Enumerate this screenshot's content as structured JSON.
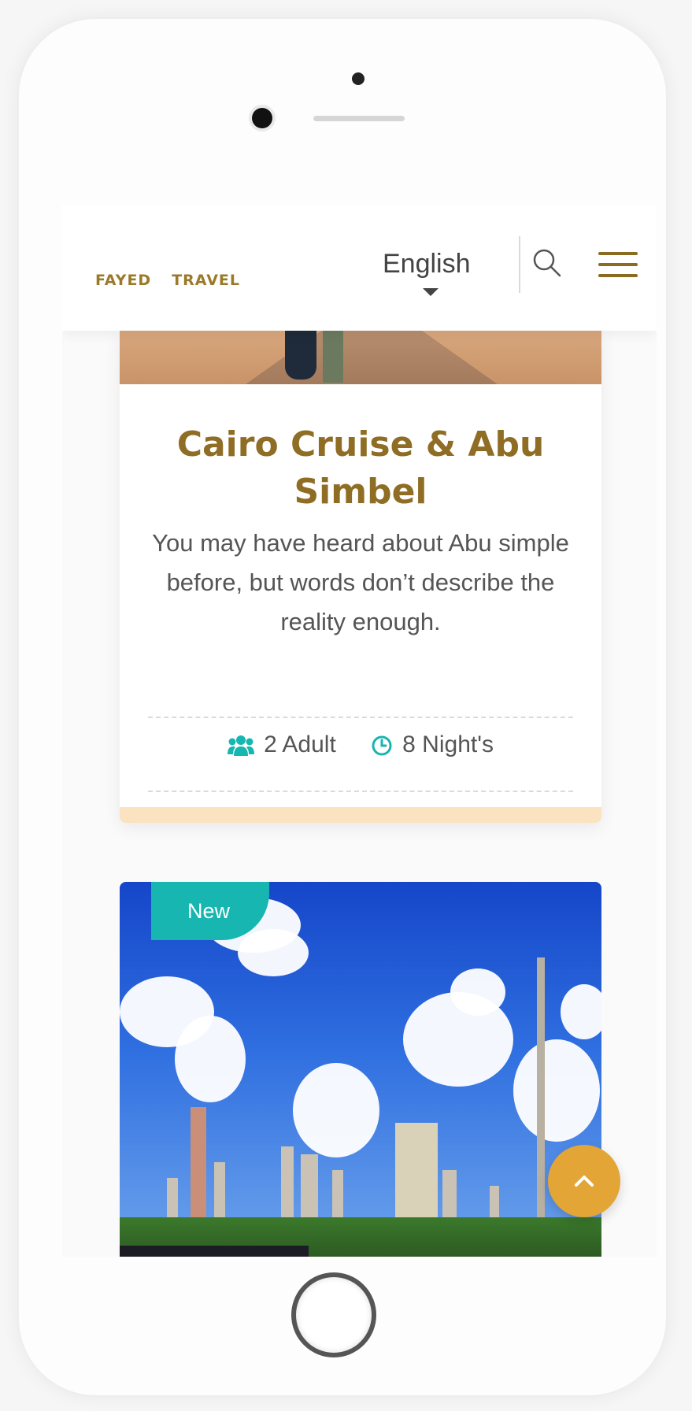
{
  "header": {
    "logo_words": [
      "FAYED",
      "TRAVEL"
    ],
    "language": "English"
  },
  "card1": {
    "title": "Cairo Cruise & Abu Simbel",
    "description": "You may have heard about Abu simple before, but words don’t describe the reality enough.",
    "adults": "2 Adult",
    "nights": "8 Night's"
  },
  "card2": {
    "badge": "New"
  },
  "colors": {
    "brand_gold": "#8f6d24",
    "teal": "#17b6b0",
    "scroll_button": "#e3a535",
    "card_bar": "#fbe2c0"
  },
  "icons": [
    "search-icon",
    "menu-icon",
    "users-icon",
    "clock-icon",
    "chevron-up-icon"
  ]
}
